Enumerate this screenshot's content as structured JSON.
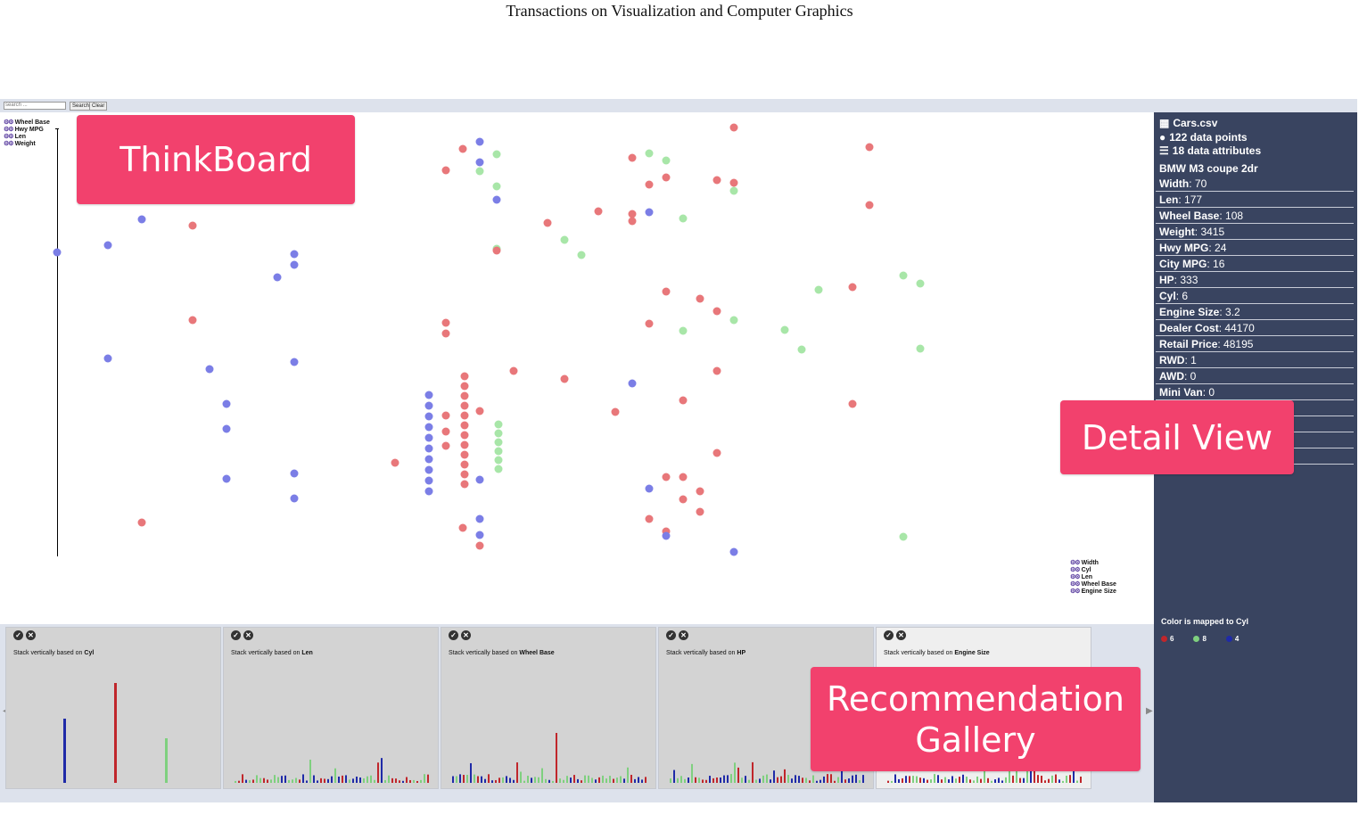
{
  "header_title": "Transactions on Visualization and Computer Graphics",
  "toolbar": {
    "search_placeholder": "search ...",
    "search_label": "Search",
    "clear_label": "Clear"
  },
  "left_legend": [
    "Wheel Base",
    "Hwy MPG",
    "Len",
    "Weight"
  ],
  "right_legend": [
    "Width",
    "Cyl",
    "Len",
    "Wheel Base",
    "Engine Size"
  ],
  "callouts": {
    "thinkboard": "ThinkBoard",
    "detail": "Detail View",
    "gallery_line1": "Recommendation",
    "gallery_line2": "Gallery"
  },
  "colors": {
    "cyl6": "#e8777a",
    "cyl8": "#a8e6a8",
    "cyl4": "#7b7ee6",
    "brand": "#f2416d",
    "panel": "#394460"
  },
  "detail": {
    "file": "Cars.csv",
    "points": "122 data points",
    "attrs": "18 data attributes",
    "selected": "BMW M3 coupe 2dr",
    "fields": [
      {
        "k": "Width",
        "v": "70"
      },
      {
        "k": "Len",
        "v": "177"
      },
      {
        "k": "Wheel Base",
        "v": "108"
      },
      {
        "k": "Weight",
        "v": "3415"
      },
      {
        "k": "Hwy MPG",
        "v": "24"
      },
      {
        "k": "City MPG",
        "v": "16"
      },
      {
        "k": "HP",
        "v": "333"
      },
      {
        "k": "Cyl",
        "v": "6"
      },
      {
        "k": "Engine Size",
        "v": "3.2"
      },
      {
        "k": "Dealer Cost",
        "v": "44170"
      },
      {
        "k": "Retail Price",
        "v": "48195"
      },
      {
        "k": "RWD",
        "v": "1"
      },
      {
        "k": "AWD",
        "v": "0"
      },
      {
        "k": "Mini Van",
        "v": "0"
      }
    ],
    "color_mapping": "Color is mapped to Cyl",
    "color_keys": [
      {
        "label": "6",
        "color": "#c0262b"
      },
      {
        "label": "8",
        "color": "#7fd07f"
      },
      {
        "label": "4",
        "color": "#1f2aa8"
      }
    ]
  },
  "gallery": {
    "prefix": "Stack vertically based on",
    "cards": [
      {
        "attr": "Cyl"
      },
      {
        "attr": "Len"
      },
      {
        "attr": "Wheel Base"
      },
      {
        "attr": "HP"
      },
      {
        "attr": "Engine Size"
      }
    ]
  }
}
